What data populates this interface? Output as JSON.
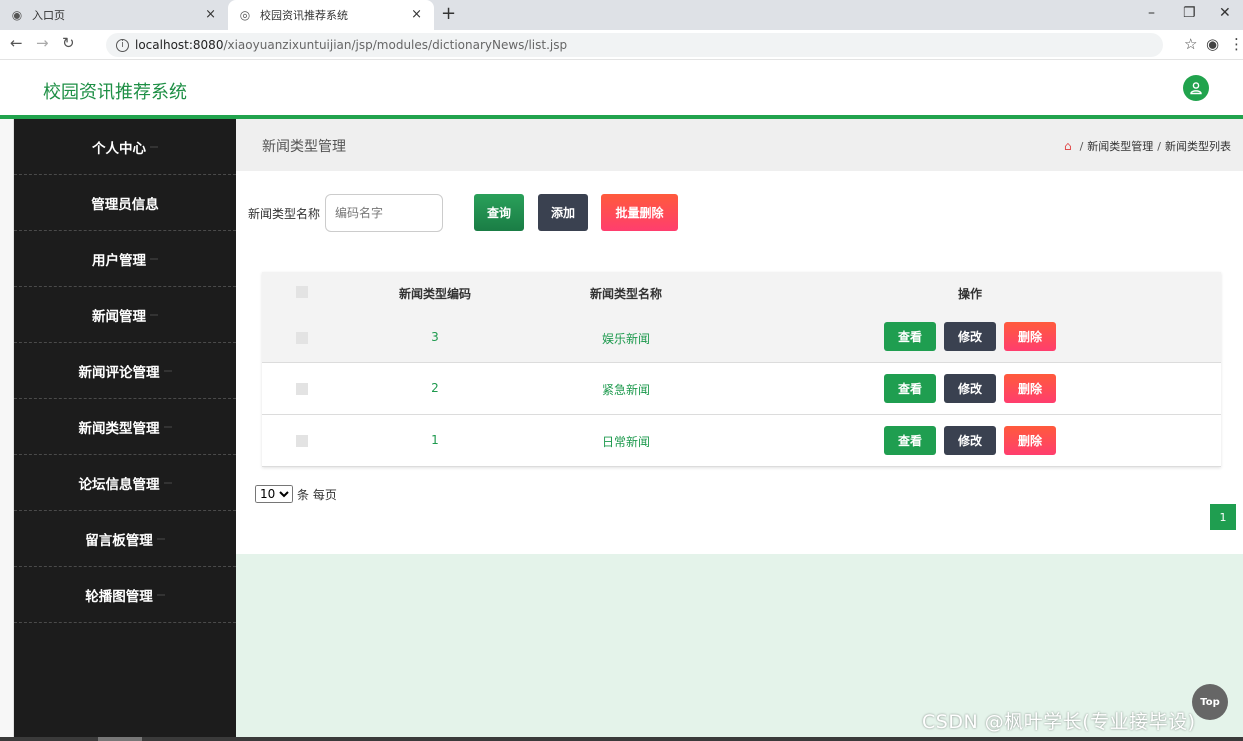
{
  "browser": {
    "tabs": [
      {
        "title": "入口页",
        "close": "×"
      },
      {
        "title": "校园资讯推荐系统",
        "close": "×"
      }
    ],
    "new_tab": "+",
    "url_host": "localhost:8080",
    "url_path": "/xiaoyuanzixuntuijian/jsp/modules/dictionaryNews/list.jsp"
  },
  "header": {
    "brand": "校园资讯推荐系统"
  },
  "sidebar": {
    "items": [
      {
        "label": "个人中心"
      },
      {
        "label": "管理员信息"
      },
      {
        "label": "用户管理"
      },
      {
        "label": "新闻管理"
      },
      {
        "label": "新闻评论管理"
      },
      {
        "label": "新闻类型管理"
      },
      {
        "label": "论坛信息管理"
      },
      {
        "label": "留言板管理"
      },
      {
        "label": "轮播图管理"
      }
    ]
  },
  "page": {
    "title": "新闻类型管理",
    "breadcrumb": [
      "新闻类型管理",
      "新闻类型列表"
    ],
    "breadcrumb_sep": "/"
  },
  "search": {
    "label": "新闻类型名称",
    "placeholder": "编码名字",
    "query_label": "查询",
    "add_label": "添加",
    "batch_delete_label": "批量删除"
  },
  "table": {
    "headers": {
      "code": "新闻类型编码",
      "name": "新闻类型名称",
      "ops": "操作"
    },
    "rows": [
      {
        "code": "3",
        "name": "娱乐新闻"
      },
      {
        "code": "2",
        "name": "紧急新闻"
      },
      {
        "code": "1",
        "name": "日常新闻"
      }
    ],
    "row_actions": {
      "view": "查看",
      "edit": "修改",
      "delete": "删除"
    }
  },
  "pagination": {
    "page_size": "10",
    "page_size_suffix": "条 每页",
    "current_page": "1"
  },
  "back_to_top": "Top",
  "watermark": "CSDN @枫叶学长(专业接毕设)",
  "colors": {
    "accent": "#21a34d",
    "sidebar": "#1c1c1c",
    "danger": "#ff4a55",
    "dark_button": "#3a4150"
  }
}
